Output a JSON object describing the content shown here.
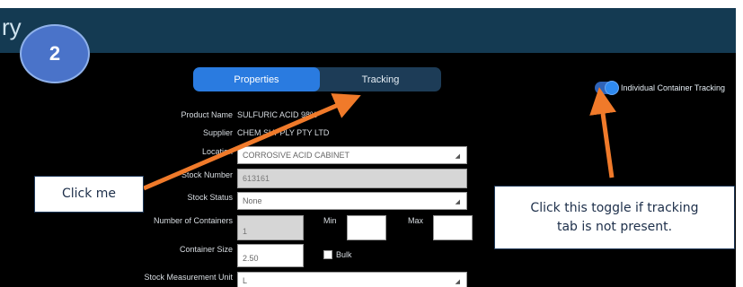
{
  "app": {
    "title_fragment": "ry",
    "step_number": "2"
  },
  "tabs": [
    {
      "label": "Properties",
      "active": true
    },
    {
      "label": "Tracking",
      "active": false
    }
  ],
  "toggle": {
    "label": "Individual Container Tracking",
    "on": true
  },
  "form": {
    "product_name": {
      "label": "Product Name",
      "value": "SULFURIC ACID 98%"
    },
    "supplier": {
      "label": "Supplier",
      "value": "CHEM SUPPLY PTY LTD"
    },
    "location": {
      "label": "Location",
      "value": "CORROSIVE ACID CABINET"
    },
    "stock_number": {
      "label": "Stock Number",
      "value": "613161"
    },
    "stock_status": {
      "label": "Stock Status",
      "value": "None"
    },
    "containers": {
      "label": "Number of Containers",
      "value": "1"
    },
    "min": {
      "label": "Min",
      "value": ""
    },
    "max": {
      "label": "Max",
      "value": ""
    },
    "container_size": {
      "label": "Container Size",
      "value": "2.50"
    },
    "bulk": {
      "label": "Bulk",
      "checked": false
    },
    "measurement_unit": {
      "label": "Stock Measurement Unit",
      "value": "L"
    }
  },
  "callouts": {
    "click_me": "Click me",
    "toggle_hint": "Click this toggle if tracking tab is not present."
  },
  "colors": {
    "header": "#143a52",
    "active_tab": "#2a7be0",
    "arrow": "#f07a2a"
  }
}
